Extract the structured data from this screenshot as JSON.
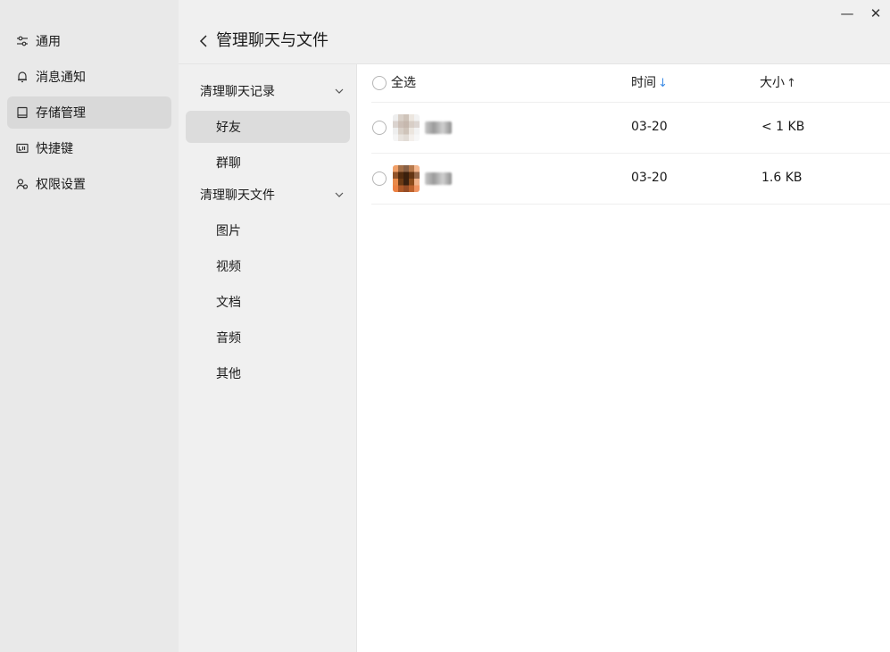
{
  "sidebar": {
    "items": [
      {
        "label": "通用",
        "icon": "sliders-icon",
        "active": false
      },
      {
        "label": "消息通知",
        "icon": "bell-icon",
        "active": false
      },
      {
        "label": "存储管理",
        "icon": "storage-icon",
        "active": true
      },
      {
        "label": "快捷键",
        "icon": "keyboard-icon",
        "active": false
      },
      {
        "label": "权限设置",
        "icon": "users-icon",
        "active": false
      }
    ]
  },
  "header": {
    "title": "管理聊天与文件",
    "back_icon": "chevron-left-icon",
    "minimize": "—",
    "close": "✕"
  },
  "middle": {
    "groups": [
      {
        "label": "清理聊天记录",
        "items": [
          "好友",
          "群聊"
        ]
      },
      {
        "label": "清理聊天文件",
        "items": [
          "图片",
          "视频",
          "文档",
          "音频",
          "其他"
        ]
      }
    ],
    "active_item": "好友"
  },
  "table": {
    "select_all": "全选",
    "col_time": "时间",
    "col_size": "大小",
    "time_sort": "↓",
    "size_sort": "↑",
    "rows": [
      {
        "time": "03-20",
        "size": "< 1 KB"
      },
      {
        "time": "03-20",
        "size": "1.6 KB"
      }
    ]
  },
  "colors": {
    "accent_blue": "#3d8ce6",
    "sidebar_bg": "#e9e9e9",
    "active_bg": "#d9d9d9"
  }
}
